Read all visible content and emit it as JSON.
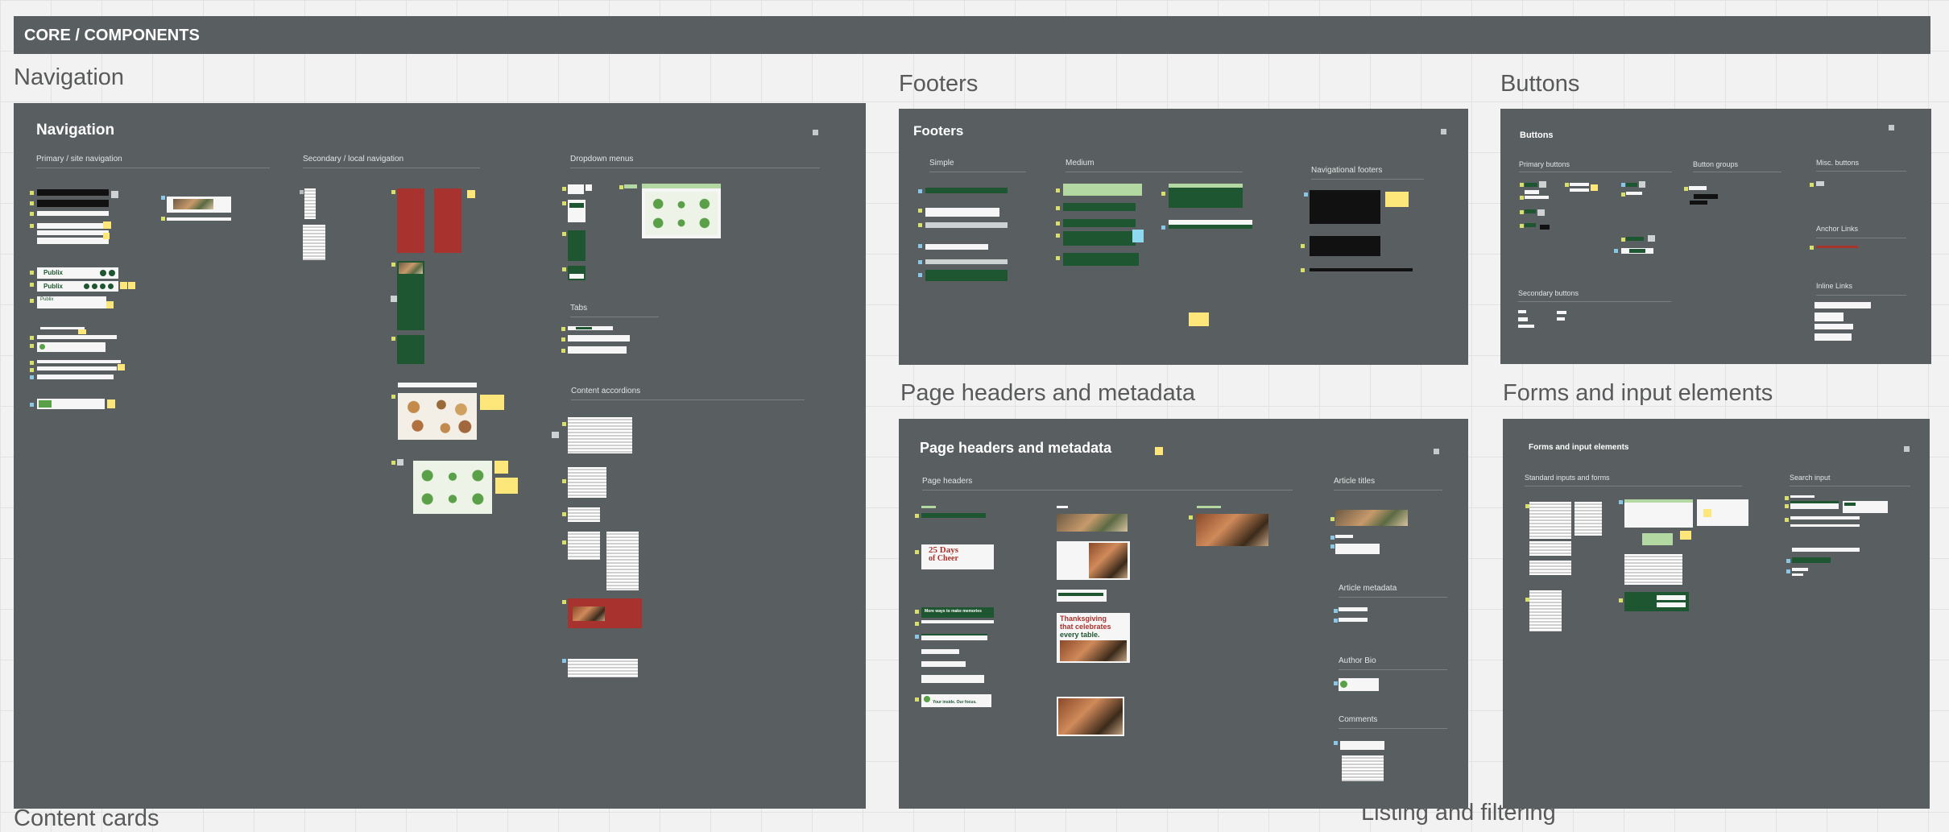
{
  "banner": {
    "title": "CORE / COMPONENTS"
  },
  "sections": {
    "navigation": "Navigation",
    "footers": "Footers",
    "buttons": "Buttons",
    "page_headers": "Page headers and metadata",
    "forms": "Forms and input elements",
    "content_cards": "Content cards",
    "listing": "Listing and filtering"
  },
  "frames": {
    "navigation": {
      "title": "Navigation",
      "subs": [
        "Primary / site navigation",
        "Secondary / local navigation",
        "Dropdown menus",
        "Tabs",
        "Content accordions"
      ]
    },
    "footers": {
      "title": "Footers",
      "subs": [
        "Simple",
        "Medium",
        "Navigational footers"
      ]
    },
    "buttons": {
      "title": "Buttons",
      "subs": [
        "Primary buttons",
        "Button groups",
        "Misc. buttons",
        "Anchor Links",
        "Secondary buttons",
        "Inline Links"
      ]
    },
    "page_headers": {
      "title": "Page headers and metadata",
      "subs": [
        "Page headers",
        "Article titles",
        "Article metadata",
        "Author Bio",
        "Comments"
      ],
      "hero_line1": "25 Days",
      "hero_line2": "of Cheer",
      "thanks_1": "Thanksgiving",
      "thanks_2": "that celebrates",
      "thanks_3": "every table.",
      "stack_1": "More ways to make memories",
      "stack_2": "Your inside. Our focus."
    },
    "forms": {
      "title": "Forms and input elements",
      "subs": [
        "Standard inputs and forms",
        "Search input"
      ]
    }
  },
  "thumb_text": {
    "brand_1": "Publix",
    "brand_2": "Publix",
    "nav_brand": "Publix"
  }
}
